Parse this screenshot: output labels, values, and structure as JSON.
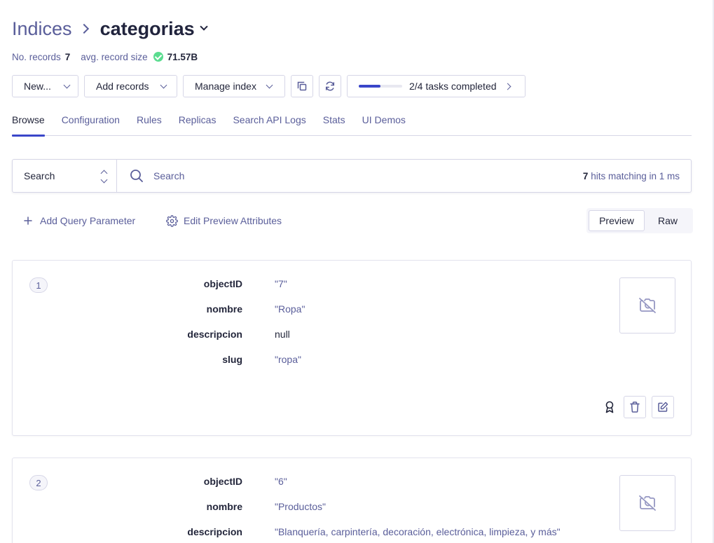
{
  "header": {
    "breadcrumb_root": "Indices",
    "index_name": "categorias"
  },
  "meta": {
    "records_label": "No. records",
    "records_value": "7",
    "size_label": "avg. record size",
    "size_value": "71.57B"
  },
  "toolbar": {
    "new_label": "New...",
    "add_records_label": "Add records",
    "manage_index_label": "Manage index",
    "tasks_label": "2/4 tasks completed",
    "tasks_progress": 0.5
  },
  "tabs": [
    {
      "label": "Browse",
      "active": true
    },
    {
      "label": "Configuration"
    },
    {
      "label": "Rules"
    },
    {
      "label": "Replicas"
    },
    {
      "label": "Search API Logs"
    },
    {
      "label": "Stats"
    },
    {
      "label": "UI Demos"
    }
  ],
  "search": {
    "mode": "Search",
    "placeholder": "Search",
    "hits_count": "7",
    "hits_text": " hits matching in 1 ms"
  },
  "query": {
    "add_param_label": "Add Query Parameter",
    "edit_preview_label": "Edit Preview Attributes"
  },
  "view_toggle": {
    "preview_label": "Preview",
    "raw_label": "Raw",
    "selected": "Preview"
  },
  "records": [
    {
      "index": "1",
      "fields": [
        {
          "key": "objectID",
          "value": "\"7\""
        },
        {
          "key": "nombre",
          "value": "\"Ropa\""
        },
        {
          "key": "descripcion",
          "value": "null"
        },
        {
          "key": "slug",
          "value": "\"ropa\""
        }
      ]
    },
    {
      "index": "2",
      "fields": [
        {
          "key": "objectID",
          "value": "\"6\""
        },
        {
          "key": "nombre",
          "value": "\"Productos\""
        },
        {
          "key": "descripcion",
          "value": "\"Blanquería, carpintería, decoración, electrónica, limpieza, y más\""
        }
      ]
    }
  ],
  "icons": {
    "copy": "copy-icon",
    "refresh": "refresh-icon",
    "search": "search-icon",
    "plus": "plus-icon",
    "gear": "gear-icon",
    "no_image": "camera-off-icon",
    "badge": "award-icon",
    "delete": "trash-icon",
    "edit": "edit-icon"
  },
  "colors": {
    "accent": "#3a46c9",
    "muted_text": "#5a5e9a",
    "border": "#d6d6e7",
    "success": "#5adc8f"
  }
}
